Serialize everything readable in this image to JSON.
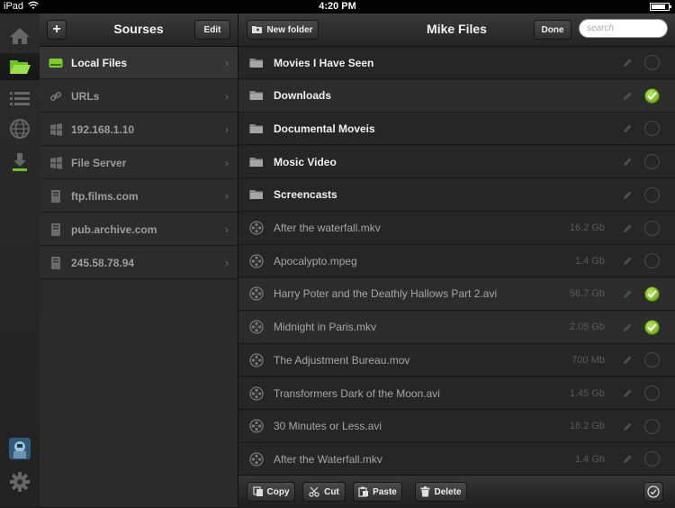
{
  "status": {
    "carrier": "iPad",
    "time": "4:20 PM"
  },
  "rail": {
    "icons": [
      "home-icon",
      "folder-icon",
      "list-icon",
      "globe-icon",
      "download-icon",
      "avatar-icon",
      "gear-icon"
    ]
  },
  "sources": {
    "title": "Sourses",
    "add_label": "+",
    "edit_label": "Edit",
    "items": [
      {
        "label": "Local Files",
        "icon": "drive-icon"
      },
      {
        "label": "URLs",
        "icon": "link-icon"
      },
      {
        "label": "192.168.1.10",
        "icon": "windows-icon"
      },
      {
        "label": "File Server",
        "icon": "windows-icon"
      },
      {
        "label": "ftp.films.com",
        "icon": "server-icon"
      },
      {
        "label": "pub.archive.com",
        "icon": "server-icon"
      },
      {
        "label": "245.58.78.94",
        "icon": "server-icon"
      }
    ]
  },
  "files": {
    "title": "Mike  Files",
    "new_folder_label": "New folder",
    "done_label": "Done",
    "search_placeholder": "search",
    "items": [
      {
        "name": "Movies  I  Have  Seen",
        "size": "",
        "type": "folder",
        "checked": false
      },
      {
        "name": "Downloads",
        "size": "",
        "type": "folder",
        "checked": true
      },
      {
        "name": "Documental  Moveis",
        "size": "",
        "type": "folder",
        "checked": false
      },
      {
        "name": "Mosic  Video",
        "size": "",
        "type": "folder",
        "checked": false
      },
      {
        "name": "Screencasts",
        "size": "",
        "type": "folder",
        "checked": false
      },
      {
        "name": "After  the  waterfall.mkv",
        "size": "16.2  Gb",
        "type": "file",
        "checked": false
      },
      {
        "name": "Apocalypto.mpeg",
        "size": "1.4  Gb",
        "type": "file",
        "checked": false
      },
      {
        "name": "Harry Poter and the Deathly Hallows Part 2.avi",
        "size": "56.7  Gb",
        "type": "file",
        "checked": true
      },
      {
        "name": "Midnight in Paris.mkv",
        "size": "2.05 Gb",
        "type": "file",
        "checked": true
      },
      {
        "name": "The Adjustment Bureau.mov",
        "size": "700 Mb",
        "type": "file",
        "checked": false
      },
      {
        "name": "Transformers Dark of the Moon.avi",
        "size": "1.45 Gb",
        "type": "file",
        "checked": false
      },
      {
        "name": "30 Minutes or Less.avi",
        "size": "16.2 Gb",
        "type": "file",
        "checked": false
      },
      {
        "name": "After the Waterfall.mkv",
        "size": "1.4 Gb",
        "type": "file",
        "checked": false
      }
    ]
  },
  "toolbar": {
    "copy_label": "Copy",
    "cut_label": "Cut",
    "paste_label": "Paste",
    "delete_label": "Delete"
  },
  "colors": {
    "check_on": "#7cbf26",
    "panel": "#262626"
  }
}
